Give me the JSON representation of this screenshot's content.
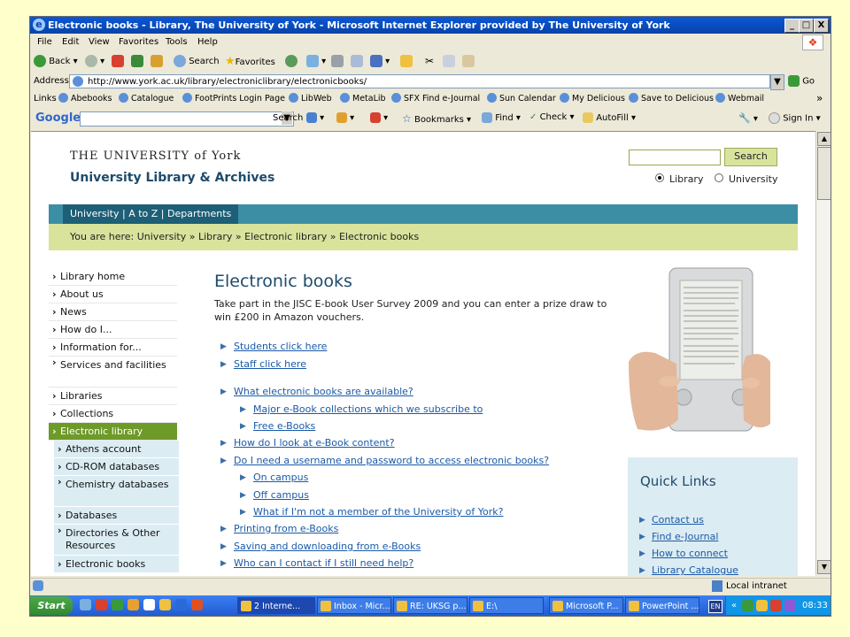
{
  "window": {
    "title": "Electronic books - Library, The University of York - Microsoft Internet Explorer provided by The University of York",
    "controls": {
      "minimize": "_",
      "maximize": "□",
      "close": "X"
    }
  },
  "menu": [
    "File",
    "Edit",
    "View",
    "Favorites",
    "Tools",
    "Help"
  ],
  "toolbar": {
    "back": "Back",
    "search": "Search",
    "favorites": "Favorites"
  },
  "address": {
    "label": "Address",
    "url": "http://www.york.ac.uk/library/electroniclibrary/electronicbooks/",
    "go": "Go"
  },
  "links_bar": {
    "label": "Links",
    "items": [
      "Abebooks",
      "Catalogue",
      "FootPrints Login Page",
      "LibWeb",
      "MetaLib",
      "SFX Find e-Journal",
      "Sun Calendar",
      "My Delicious",
      "Save to Delicious",
      "Webmail"
    ],
    "more": "»"
  },
  "google_bar": {
    "logo": "Google",
    "search": "Search",
    "bookmarks": "Bookmarks",
    "find": "Find",
    "check": "Check",
    "autofill": "AutoFill",
    "sign_in": "Sign In"
  },
  "site": {
    "logo_line1": "THE UNIVERSITY of York",
    "logo_line2": "University Library & Archives",
    "search_button": "Search",
    "radio_library": "Library",
    "radio_university": "University",
    "teal_nav": "University | A to Z | Departments",
    "breadcrumb": "You are here:  University  » Library » Electronic library » Electronic books"
  },
  "sidenav": [
    {
      "label": "Library home"
    },
    {
      "label": "About us"
    },
    {
      "label": "News"
    },
    {
      "label": "How do I..."
    },
    {
      "label": "Information for..."
    },
    {
      "label": "Services and facilities"
    },
    {
      "label": "Libraries"
    },
    {
      "label": "Collections"
    },
    {
      "label": "Electronic library"
    },
    {
      "label": "Athens account"
    },
    {
      "label": "CD-ROM databases"
    },
    {
      "label": "Chemistry databases"
    },
    {
      "label": "Databases"
    },
    {
      "label": "Directories & Other Resources"
    },
    {
      "label": "Electronic books"
    }
  ],
  "main": {
    "title": "Electronic books",
    "intro": "Take part in the JISC E-book User Survey 2009 and you can enter a prize draw to win £200 in Amazon vouchers.",
    "links": [
      "Students click here",
      "Staff click here",
      "What electronic books are available?",
      "Major e-Book collections which we subscribe to",
      "Free e-Books",
      "How do I look at e-Book content?",
      "Do I need a username and password to access electronic books?",
      "On campus",
      "Off campus",
      "What if I'm not a member of the University of York?",
      "Printing from e-Books",
      "Saving and downloading from e-Books",
      "Who can I contact if I still need help?"
    ]
  },
  "quick_links": {
    "title": "Quick Links",
    "items": [
      "Contact us",
      "Find e-Journal",
      "How to connect",
      "Library Catalogue"
    ]
  },
  "status": {
    "zone": "Local intranet"
  },
  "taskbar": {
    "start": "Start",
    "tasks": [
      "2 Interne...",
      "Inbox - Micr...",
      "RE: UKSG p...",
      "E:\\",
      "Microsoft P...",
      "PowerPoint ..."
    ],
    "lang": "EN",
    "clock": "08:33"
  }
}
